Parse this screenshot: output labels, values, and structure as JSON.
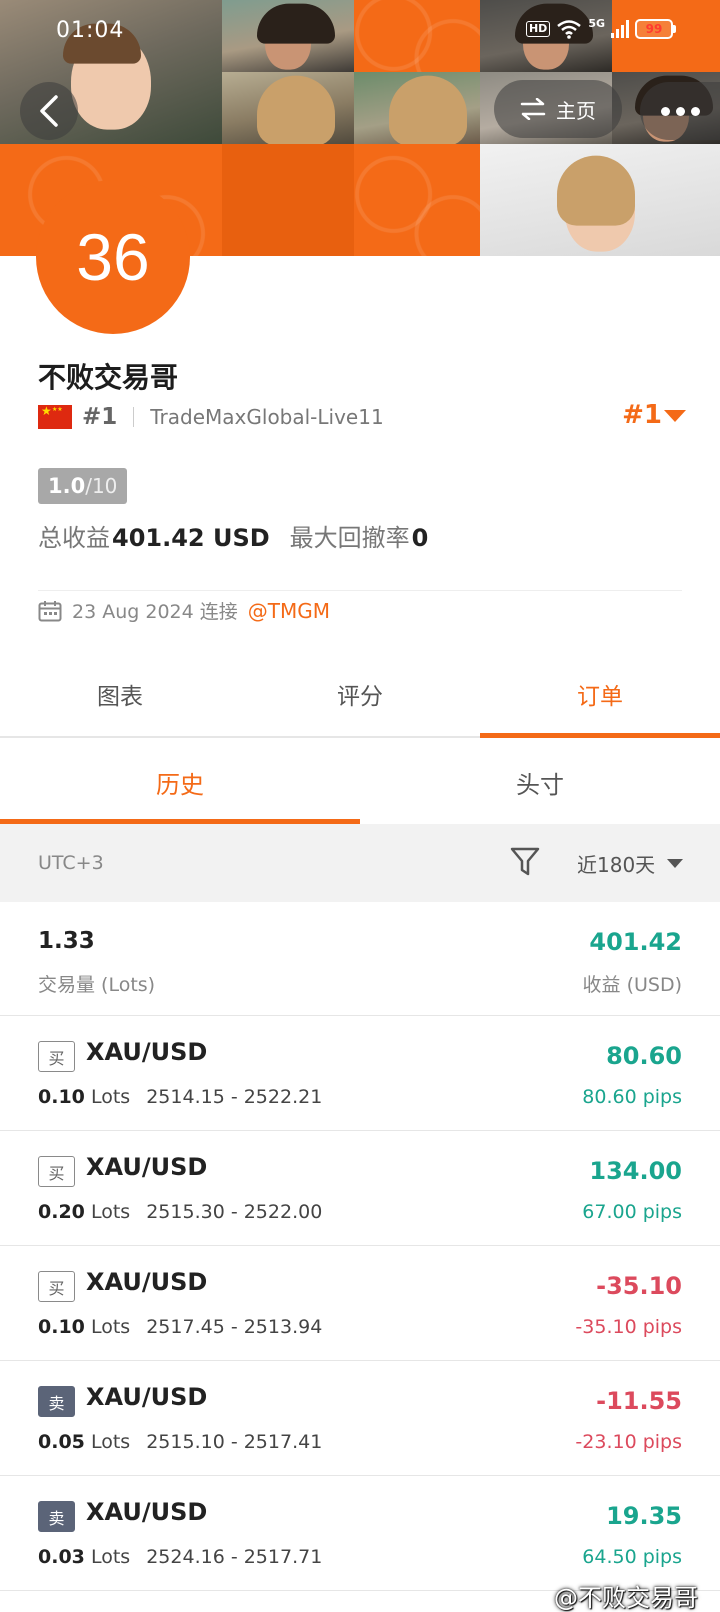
{
  "status_bar": {
    "time": "01:04",
    "hd": "HD",
    "network": "5G",
    "battery": "99"
  },
  "header": {
    "home_label": "主页",
    "rank_number": "36"
  },
  "profile": {
    "name": "不败交易哥",
    "country_rank": "#1",
    "server": "TradeMaxGlobal-Live11",
    "overall_rank": "#1",
    "score": "1.0",
    "score_max": "/10",
    "total_profit_label": "总收益",
    "total_profit_value": "401.42 USD",
    "max_drawdown_label": "最大回撤率",
    "max_drawdown_value": "0",
    "join_date": "23 Aug 2024 连接",
    "broker_link": "@TMGM"
  },
  "main_tabs": [
    {
      "label": "图表"
    },
    {
      "label": "评分"
    },
    {
      "label": "订单"
    }
  ],
  "sub_tabs": [
    {
      "label": "历史"
    },
    {
      "label": "头寸"
    }
  ],
  "filter": {
    "timezone": "UTC+3",
    "range": "近180天"
  },
  "summary": {
    "lots_value": "1.33",
    "lots_label": "交易量 (Lots)",
    "profit_value": "401.42",
    "profit_label": "收益 (USD)"
  },
  "orders": [
    {
      "side": "买",
      "symbol": "XAU/USD",
      "lots": "0.10",
      "lots_unit": "Lots",
      "prices": "2514.15 - 2522.21",
      "profit": "80.60",
      "pips": "80.60 pips"
    },
    {
      "side": "买",
      "symbol": "XAU/USD",
      "lots": "0.20",
      "lots_unit": "Lots",
      "prices": "2515.30 - 2522.00",
      "profit": "134.00",
      "pips": "67.00 pips"
    },
    {
      "side": "买",
      "symbol": "XAU/USD",
      "lots": "0.10",
      "lots_unit": "Lots",
      "prices": "2517.45 - 2513.94",
      "profit": "-35.10",
      "pips": "-35.10 pips"
    },
    {
      "side": "卖",
      "symbol": "XAU/USD",
      "lots": "0.05",
      "lots_unit": "Lots",
      "prices": "2515.10 - 2517.41",
      "profit": "-11.55",
      "pips": "-23.10 pips"
    },
    {
      "side": "卖",
      "symbol": "XAU/USD",
      "lots": "0.03",
      "lots_unit": "Lots",
      "prices": "2524.16 - 2517.71",
      "profit": "19.35",
      "pips": "64.50 pips"
    }
  ],
  "watermark": "@不败交易哥",
  "colors": {
    "accent": "#f46a17",
    "positive": "#1aa58e",
    "negative": "#dc4a5d"
  }
}
